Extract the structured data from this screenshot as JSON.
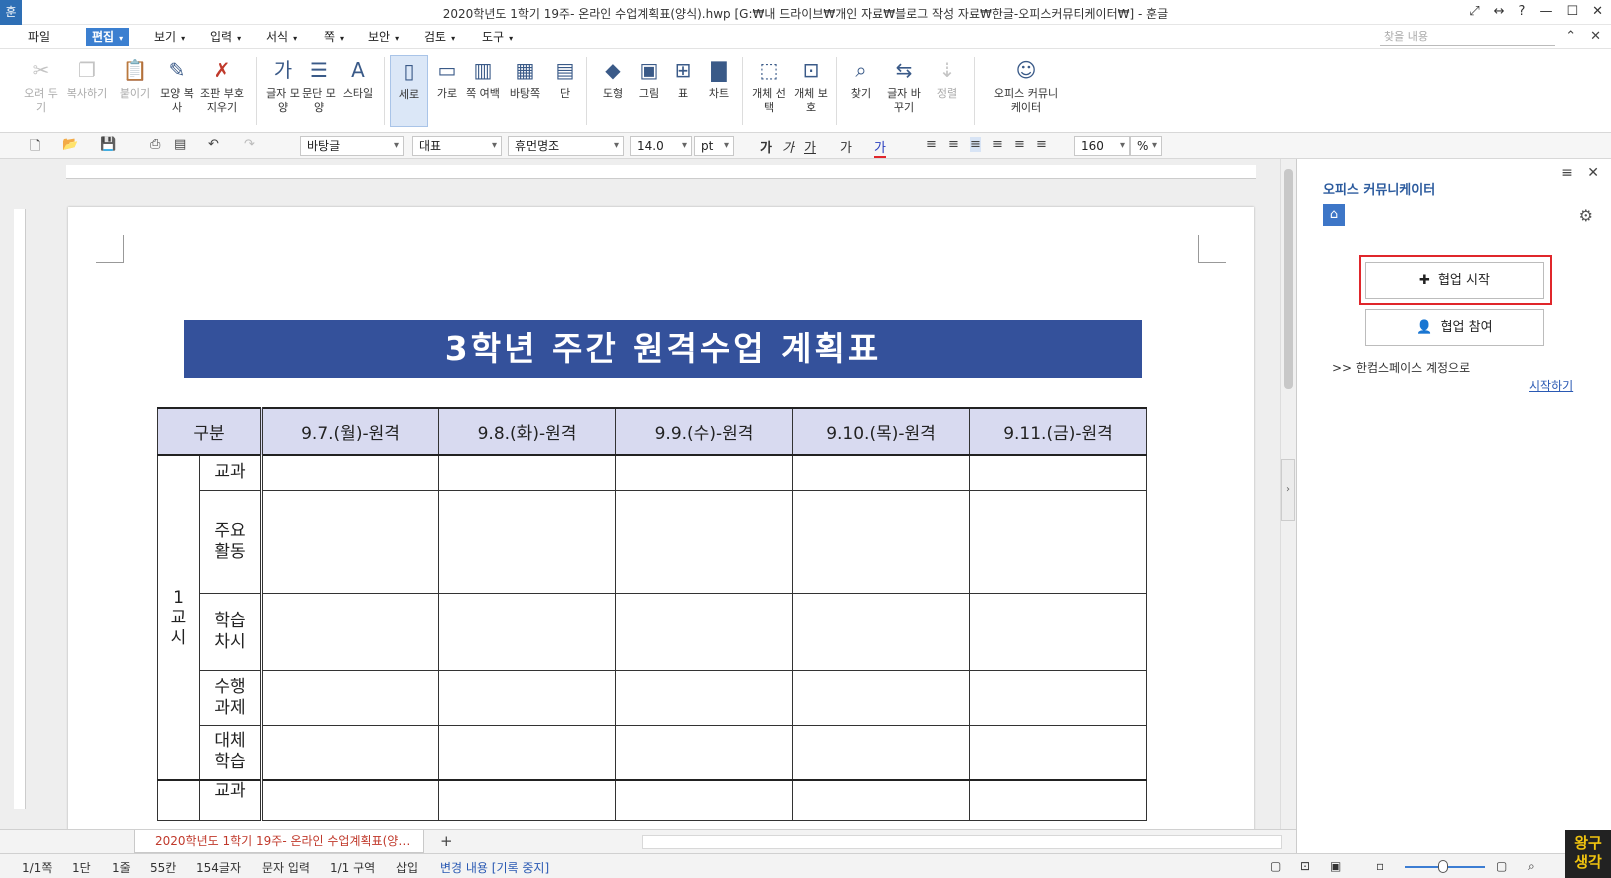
{
  "window": {
    "app_icon": "훈",
    "title": "2020학년도 1학기 19주- 온라인 수업계획표(양식).hwp [G:₩내 드라이브₩개인 자료₩블로그 작성 자료₩한글-오피스커뮤티케이터₩] - 훈글"
  },
  "menu": {
    "items": [
      "파일",
      "편집",
      "보기",
      "입력",
      "서식",
      "쪽",
      "보안",
      "검토",
      "도구"
    ],
    "search_placeholder": "찾을 내용"
  },
  "ribbon": {
    "cut": "오려 두기",
    "copy": "복사하기",
    "paste": "붙이기",
    "format_copy": "모양 복사",
    "clear_format": "조판 부호 지우기",
    "char_shape": "글자 모양",
    "para_shape": "문단 모양",
    "style": "스타일",
    "portrait": "세로",
    "landscape": "가로",
    "page_margin": "쪽 여백",
    "background_page": "바탕쪽",
    "columns": "단",
    "shape": "도형",
    "picture": "그림",
    "table": "표",
    "chart": "차트",
    "object_select": "개체 선택",
    "object_protect": "개체 보호",
    "find": "찾기",
    "replace": "글자 바꾸기",
    "sort": "정렬",
    "office_comm": "오피스 커뮤니케이터"
  },
  "toolbar": {
    "style_value": "바탕글",
    "lang_value": "대표",
    "font_value": "휴먼명조",
    "size_value": "14.0",
    "size_unit": "pt",
    "zoom_value": "160",
    "zoom_unit": "%"
  },
  "document": {
    "banner_title": "3학년 주간 원격수업 계획표",
    "header_cols": [
      "구분",
      "9.7.(월)-원격",
      "9.8.(화)-원격",
      "9.9.(수)-원격",
      "9.10.(목)-원격",
      "9.11.(금)-원격"
    ],
    "period_label": "1\n교\n시",
    "rows": [
      {
        "label": "교과"
      },
      {
        "label": "주요\n활동"
      },
      {
        "label": "학습\n차시"
      },
      {
        "label": "수행\n과제"
      },
      {
        "label": "대체\n학습"
      },
      {
        "label": "교과"
      }
    ]
  },
  "tabs": {
    "doc_tab": "2020학년도 1학기 19주- 온라인 수업계획표(양…",
    "add_tab": "+"
  },
  "status": {
    "page": "1/1쪽",
    "column": "1단",
    "line": "1줄",
    "char_pos": "55칸",
    "char_count": "154글자",
    "mode": "문자 입력",
    "section": "1/1 구역",
    "insert": "삽입",
    "track_changes": "변경 내용 [기록 중지]"
  },
  "sidepanel": {
    "title": "오피스 커뮤니케이터",
    "start_collab": "협업 시작",
    "join_collab": "협업 참여",
    "link_text": ">> 한컴스페이스 계정으로",
    "link": "시작하기"
  },
  "watermark": "왕구\n생각"
}
